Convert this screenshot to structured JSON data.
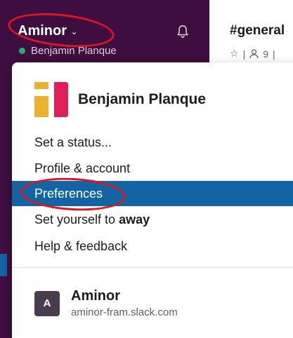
{
  "sidebar": {
    "workspace_name": "Aminor",
    "user_name": "Benjamin Planque",
    "presence_color": "#2bac76",
    "bg_color": "#3f0e40"
  },
  "channel": {
    "title": "#general",
    "meta_star": "☆",
    "meta_separator": "|",
    "meta_member_count": "9",
    "meta_trailing": "|"
  },
  "menu": {
    "profile_name": "Benjamin Planque",
    "items": [
      {
        "label": "Set a status..."
      },
      {
        "label": "Profile & account"
      },
      {
        "label": "Preferences",
        "active": true
      },
      {
        "label": "Set yourself to",
        "emphasis": "away"
      },
      {
        "label": "Help & feedback"
      }
    ],
    "workspace": {
      "avatar_letter": "A",
      "name": "Aminor",
      "domain": "aminor-fram.slack.com"
    }
  },
  "colors": {
    "accent": "#1264a3",
    "annotation": "#e0141e",
    "logo_yellow": "#ecb22e",
    "logo_red": "#e01e5a"
  },
  "icons": {
    "bell": "bell-icon",
    "chevron": "chevron-down-icon",
    "star": "star-icon",
    "members": "members-icon",
    "logo": "workspace-logo"
  }
}
